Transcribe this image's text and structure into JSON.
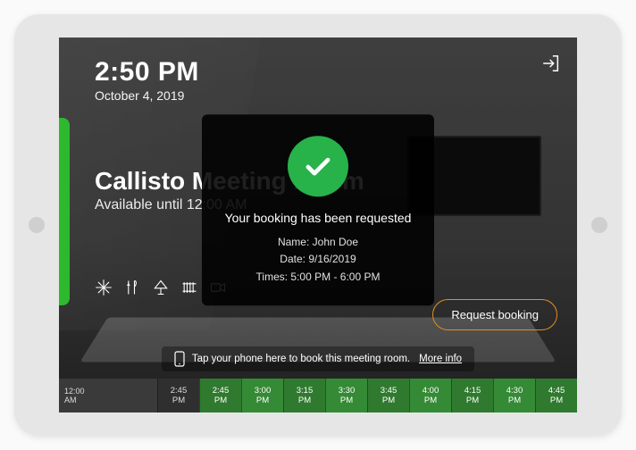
{
  "header": {
    "time": "2:50 PM",
    "date": "October 4, 2019"
  },
  "room": {
    "name": "Callisto Meeting Room",
    "availability": "Available until 12:00 AM"
  },
  "modal": {
    "message": "Your booking has been requested",
    "name_label": "Name:",
    "name_value": "John Doe",
    "date_label": "Date:",
    "date_value": "9/16/2019",
    "times_label": "Times:",
    "times_value": "5:00 PM - 6:00 PM"
  },
  "buttons": {
    "request": "Request booking"
  },
  "tap_banner": {
    "text": "Tap your phone here to book this meeting room.",
    "more": "More info"
  },
  "timeline": {
    "start_top": "12:00",
    "start_bot": "AM",
    "slots": [
      {
        "t": "2:45",
        "p": "PM",
        "style": "dark"
      },
      {
        "t": "2:45",
        "p": "PM",
        "style": "green"
      },
      {
        "t": "3:00",
        "p": "PM",
        "style": "green alt"
      },
      {
        "t": "3:15",
        "p": "PM",
        "style": "green"
      },
      {
        "t": "3:30",
        "p": "PM",
        "style": "green alt"
      },
      {
        "t": "3:45",
        "p": "PM",
        "style": "green"
      },
      {
        "t": "4:00",
        "p": "PM",
        "style": "green alt"
      },
      {
        "t": "4:15",
        "p": "PM",
        "style": "green"
      },
      {
        "t": "4:30",
        "p": "PM",
        "style": "green alt"
      },
      {
        "t": "4:45",
        "p": "PM",
        "style": "green"
      }
    ]
  },
  "amenities": [
    "snowflake-icon",
    "catering-icon",
    "presentation-icon",
    "radiator-icon",
    "av-icon"
  ],
  "colors": {
    "accent_green": "#27b24a",
    "accent_orange": "#e28f1e"
  }
}
